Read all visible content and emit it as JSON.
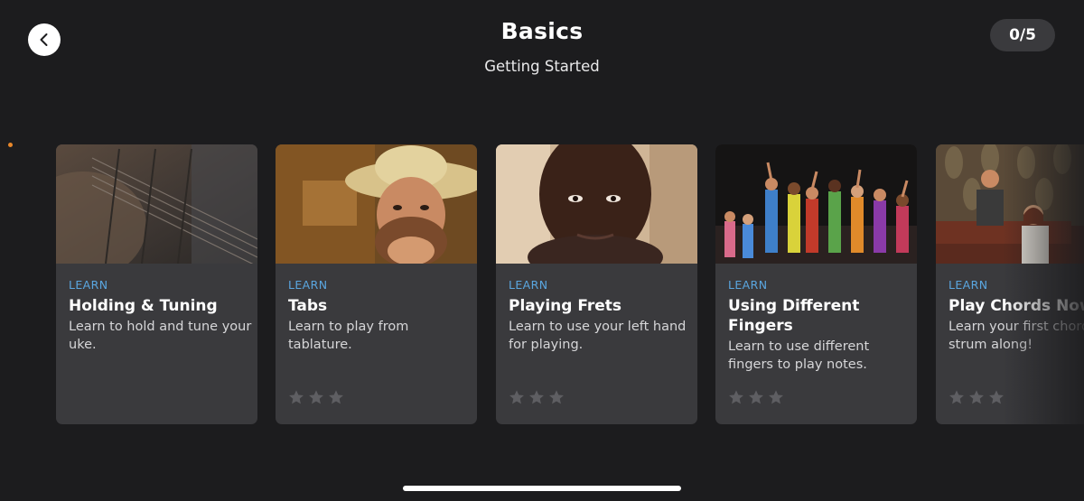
{
  "header": {
    "title": "Basics",
    "subtitle": "Getting Started",
    "progress": "0/5"
  },
  "icons": {
    "back": "chevron-left-icon",
    "rating": "star-icon"
  },
  "colors": {
    "background": "#1c1c1e",
    "card": "#3a3a3d",
    "tag": "#5aa6e0",
    "star_empty": "#5e5e62",
    "indicator_dot": "#e8872a"
  },
  "lessons": [
    {
      "tag": "LEARN",
      "title": "Holding & Tuning",
      "description": "Learn to hold and tune your uke.",
      "rating": 0,
      "max_rating": 3,
      "stars_visible": false
    },
    {
      "tag": "LEARN",
      "title": "Tabs",
      "description": "Learn to play from tablature.",
      "rating": 0,
      "max_rating": 3,
      "stars_visible": true
    },
    {
      "tag": "LEARN",
      "title": "Playing Frets",
      "description": "Learn to use your left hand for playing.",
      "rating": 0,
      "max_rating": 3,
      "stars_visible": true
    },
    {
      "tag": "LEARN",
      "title": "Using Different Fingers",
      "description": "Learn to use different fingers to play notes.",
      "rating": 0,
      "max_rating": 3,
      "stars_visible": true
    },
    {
      "tag": "LEARN",
      "title": "Play Chords Now",
      "description": "Learn your first chords and strum along!",
      "rating": 0,
      "max_rating": 3,
      "stars_visible": true
    }
  ]
}
